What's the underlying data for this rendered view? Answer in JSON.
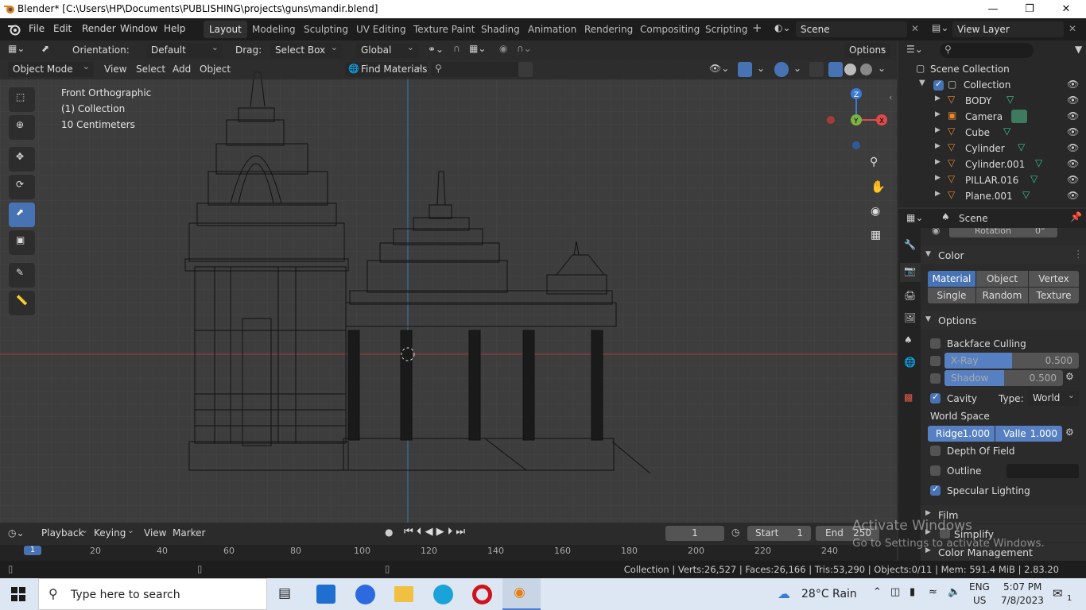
{
  "window": {
    "title": "Blender* [C:\\Users\\HP\\Documents\\PUBLISHING\\projects\\guns\\mandir.blend]"
  },
  "menubar": {
    "file": "File",
    "edit": "Edit",
    "render": "Render",
    "window": "Window",
    "help": "Help"
  },
  "workspaces": [
    "Layout",
    "Modeling",
    "Sculpting",
    "UV Editing",
    "Texture Paint",
    "Shading",
    "Animation",
    "Rendering",
    "Compositing",
    "Scripting"
  ],
  "scene": {
    "name": "Scene",
    "view_layer": "View Layer"
  },
  "toolheader": {
    "orientation_label": "Orientation:",
    "orientation_value": "Default",
    "drag_label": "Drag:",
    "drag_value": "Select Box",
    "transform_value": "Global",
    "options": "Options"
  },
  "viewport_header": {
    "mode": "Object Mode",
    "view": "View",
    "select": "Select",
    "add": "Add",
    "object": "Object",
    "find_materials": "Find Materials"
  },
  "viewport_overlay": {
    "view_name": "Front Orthographic",
    "collection": "(1) Collection",
    "scale": "10 Centimeters"
  },
  "gizmo": {
    "z": "Z",
    "y": "Y",
    "x": "X"
  },
  "outliner": {
    "root": "Scene Collection",
    "collection": "Collection",
    "items": [
      "BODY",
      "Camera",
      "Cube",
      "Cylinder",
      "Cylinder.001",
      "PILLAR.016",
      "Plane.001"
    ]
  },
  "properties": {
    "context": "Scene",
    "rotation_label": "Rotation",
    "rotation_value": "0°",
    "color_title": "Color",
    "color_options": [
      "Material",
      "Object",
      "Vertex",
      "Single",
      "Random",
      "Texture"
    ],
    "options_title": "Options",
    "backface_culling": "Backface Culling",
    "xray_label": "X-Ray",
    "xray_value": "0.500",
    "xray_fraction": 0.5,
    "shadow_label": "Shadow",
    "shadow_value": "0.500",
    "shadow_fraction": 0.5,
    "cavity_label": "Cavity",
    "type_label": "Type:",
    "type_value": "World",
    "world_space": "World Space",
    "ridge_label": "Ridge",
    "ridge_value": "1.000",
    "valley_label": "Valle",
    "valley_value": "1.000",
    "dof": "Depth Of Field",
    "outline": "Outline",
    "specular": "Specular Lighting",
    "film": "Film",
    "simplify": "Simplify",
    "color_management": "Color Management"
  },
  "timeline": {
    "playback": "Playback",
    "keying": "Keying",
    "view": "View",
    "marker": "Marker",
    "current_frame": "1",
    "start_label": "Start",
    "start": "1",
    "end_label": "End",
    "end": "250",
    "ruler": [
      "1",
      "20",
      "40",
      "60",
      "80",
      "100",
      "120",
      "140",
      "160",
      "180",
      "200",
      "220",
      "240"
    ]
  },
  "activate": {
    "line1": "Activate Windows",
    "line2": "Go to Settings to activate Windows."
  },
  "statusbar": {
    "text": "Collection | Verts:26,527 | Faces:26,166 | Tris:53,290 | Objects:0/11 | Mem: 591.4 MiB | 2.83.20"
  },
  "taskbar": {
    "search": "Type here to search",
    "weather": "28°C  Rain",
    "lang1": "ENG",
    "lang2": "US",
    "time": "5:07 PM",
    "date": "7/8/2023",
    "notif": "1"
  }
}
